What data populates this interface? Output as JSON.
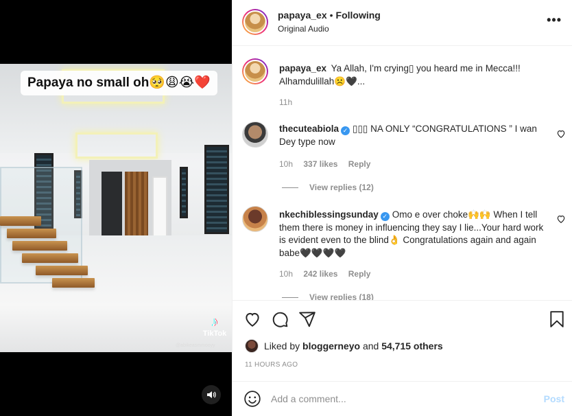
{
  "media": {
    "caption": "Papaya no small oh🥺😩😭❤️",
    "watermark": "TikTok",
    "watermark_handle": "@abikeasmmooyy",
    "sound_icon": "speaker-icon"
  },
  "header": {
    "username": "papaya_ex",
    "separator": "•",
    "follow_status": "Following",
    "audio": "Original Audio",
    "more_icon": "•••"
  },
  "comments": [
    {
      "username": "papaya_ex",
      "verified": false,
      "text": "Ya Allah, I'm crying▯ you heard me in Mecca!!! Alhamdulillah☹️🖤...",
      "time": "11h"
    },
    {
      "username": "thecuteabiola",
      "verified": true,
      "text": "▯▯▯ NA ONLY “CONGRATULATIONS ” I wan Dey type now",
      "time": "10h",
      "likes": "337 likes",
      "reply": "Reply",
      "view_replies": "View replies (12)"
    },
    {
      "username": "nkechiblessingsunday",
      "verified": true,
      "text": "Omo e over choke🙌🙌 When I tell them there is money in influencing they say I lie...Your hard work is evident even to the blind👌 Congratulations again and again babe🖤🖤🖤🖤",
      "time": "10h",
      "likes": "242 likes",
      "reply": "Reply",
      "view_replies": "View replies (18)"
    }
  ],
  "actions": {
    "liked_by_prefix": "Liked by",
    "liked_by_user": "bloggerneyo",
    "liked_by_and": "and",
    "liked_by_others": "54,715 others",
    "timestamp": "11 HOURS AGO"
  },
  "composer": {
    "placeholder": "Add a comment...",
    "post_label": "Post"
  },
  "colors": {
    "verified": "#3897f0",
    "muted": "#8e8e8e",
    "post_disabled": "#b3dbff",
    "text": "#262626"
  }
}
